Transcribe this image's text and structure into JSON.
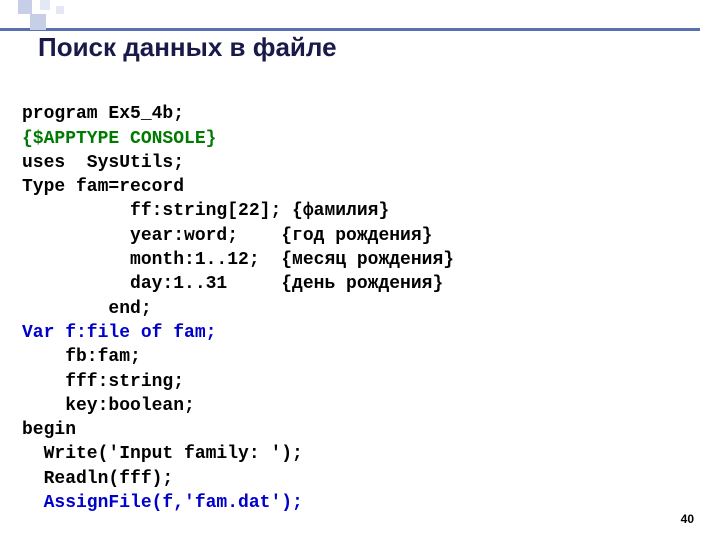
{
  "title": "Поиск данных в файле",
  "code": {
    "l1": "program Ex5_4b;",
    "l2": "{$APPTYPE CONSOLE}",
    "l3": "uses  SysUtils;",
    "l4": "Type fam=record",
    "l5": "          ff:string[22]; {фамилия}",
    "l6": "          year:word;    {год рождения}",
    "l7": "          month:1..12;  {месяц рождения}",
    "l8": "          day:1..31     {день рождения}",
    "l9": "        end;",
    "l10": "Var f:file of fam;",
    "l11": "    fb:fam;",
    "l12": "    fff:string;",
    "l13": "    key:boolean;",
    "l14": "begin",
    "l15": "  Write('Input family: ');",
    "l16": "  Readln(fff);",
    "l17": "  AssignFile(f,'fam.dat');"
  },
  "pagenum": "40"
}
